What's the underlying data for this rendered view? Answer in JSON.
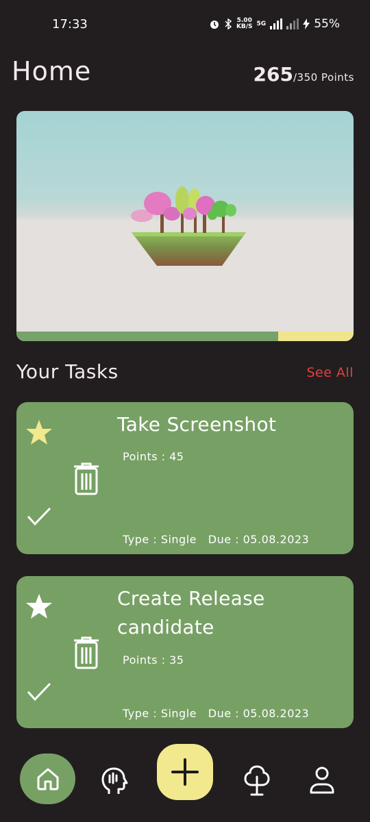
{
  "status": {
    "time": "17:33",
    "net_speed": "5.00",
    "net_unit": "KB/S",
    "network_type": "5G",
    "battery": "55%"
  },
  "header": {
    "title": "Home",
    "points_current": "265",
    "points_suffix": "/350 Points"
  },
  "garden": {
    "progress": 0.776
  },
  "tasks_section": {
    "title": "Your Tasks",
    "see_all": "See All"
  },
  "tasks": [
    {
      "title": "Take Screenshot",
      "points": "Points : 45",
      "meta": "Type : Single   Due : 05.08.2023",
      "starred": true
    },
    {
      "title": "Create Release candidate",
      "points": "Points : 35",
      "meta": "Type : Single   Due : 05.08.2023",
      "starred": false
    }
  ],
  "nav": {
    "items": [
      {
        "icon": "home-icon",
        "active": true
      },
      {
        "icon": "mind-icon",
        "active": false
      },
      {
        "icon": "plus-icon",
        "active": false
      },
      {
        "icon": "tree-icon",
        "active": false
      },
      {
        "icon": "profile-icon",
        "active": false
      }
    ]
  },
  "colors": {
    "background": "#221e1f",
    "card": "#77a065",
    "accent_yellow": "#f2e88d",
    "see_all": "#e24141"
  }
}
